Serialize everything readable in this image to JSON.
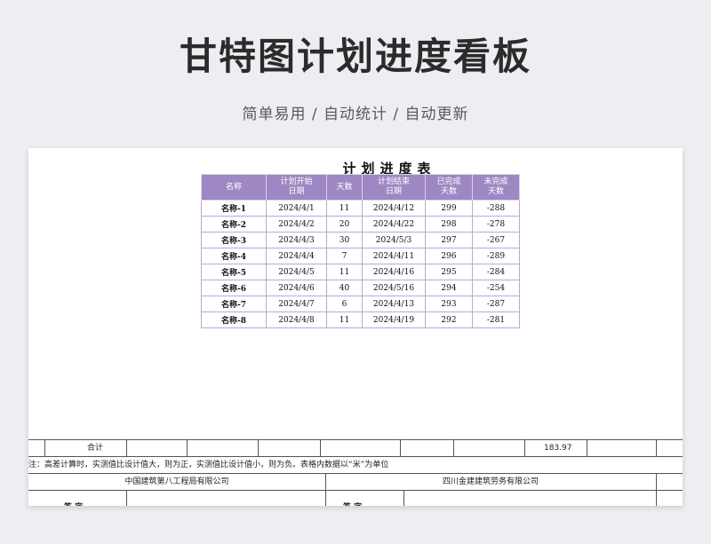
{
  "header": {
    "title": "甘特图计划进度看板",
    "subtitle": "简单易用 / 自动统计 / 自动更新"
  },
  "sheet": {
    "title": "计划进度表",
    "columns": [
      {
        "line1": "名称",
        "line2": ""
      },
      {
        "line1": "计划开始",
        "line2": "日期"
      },
      {
        "line1": "天数",
        "line2": ""
      },
      {
        "line1": "计划结束",
        "line2": "日期"
      },
      {
        "line1": "已完成",
        "line2": "天数"
      },
      {
        "line1": "未完成",
        "line2": "天数"
      }
    ],
    "rows": [
      [
        "名称-1",
        "2024/4/1",
        "11",
        "2024/4/12",
        "299",
        "-288"
      ],
      [
        "名称-2",
        "2024/4/2",
        "20",
        "2024/4/22",
        "298",
        "-278"
      ],
      [
        "名称-3",
        "2024/4/3",
        "30",
        "2024/5/3",
        "297",
        "-267"
      ],
      [
        "名称-4",
        "2024/4/4",
        "7",
        "2024/4/11",
        "296",
        "-289"
      ],
      [
        "名称-5",
        "2024/4/5",
        "11",
        "2024/4/16",
        "295",
        "-284"
      ],
      [
        "名称-6",
        "2024/4/6",
        "40",
        "2024/5/16",
        "294",
        "-254"
      ],
      [
        "名称-7",
        "2024/4/7",
        "6",
        "2024/4/13",
        "293",
        "-287"
      ],
      [
        "名称-8",
        "2024/4/8",
        "11",
        "2024/4/19",
        "292",
        "-281"
      ]
    ]
  },
  "footer": {
    "total_label": "合计",
    "total_value": "183.97",
    "note": "注：高差计算时，实测值比设计值大，则为正，实测值比设计值小，则为负。表格内数据以“米”为单位",
    "company_left": "中国建筑第八工程局有限公司",
    "company_right": "四川金建建筑劳务有限公司",
    "sign_left": "签 字",
    "sign_right": "签 字"
  }
}
